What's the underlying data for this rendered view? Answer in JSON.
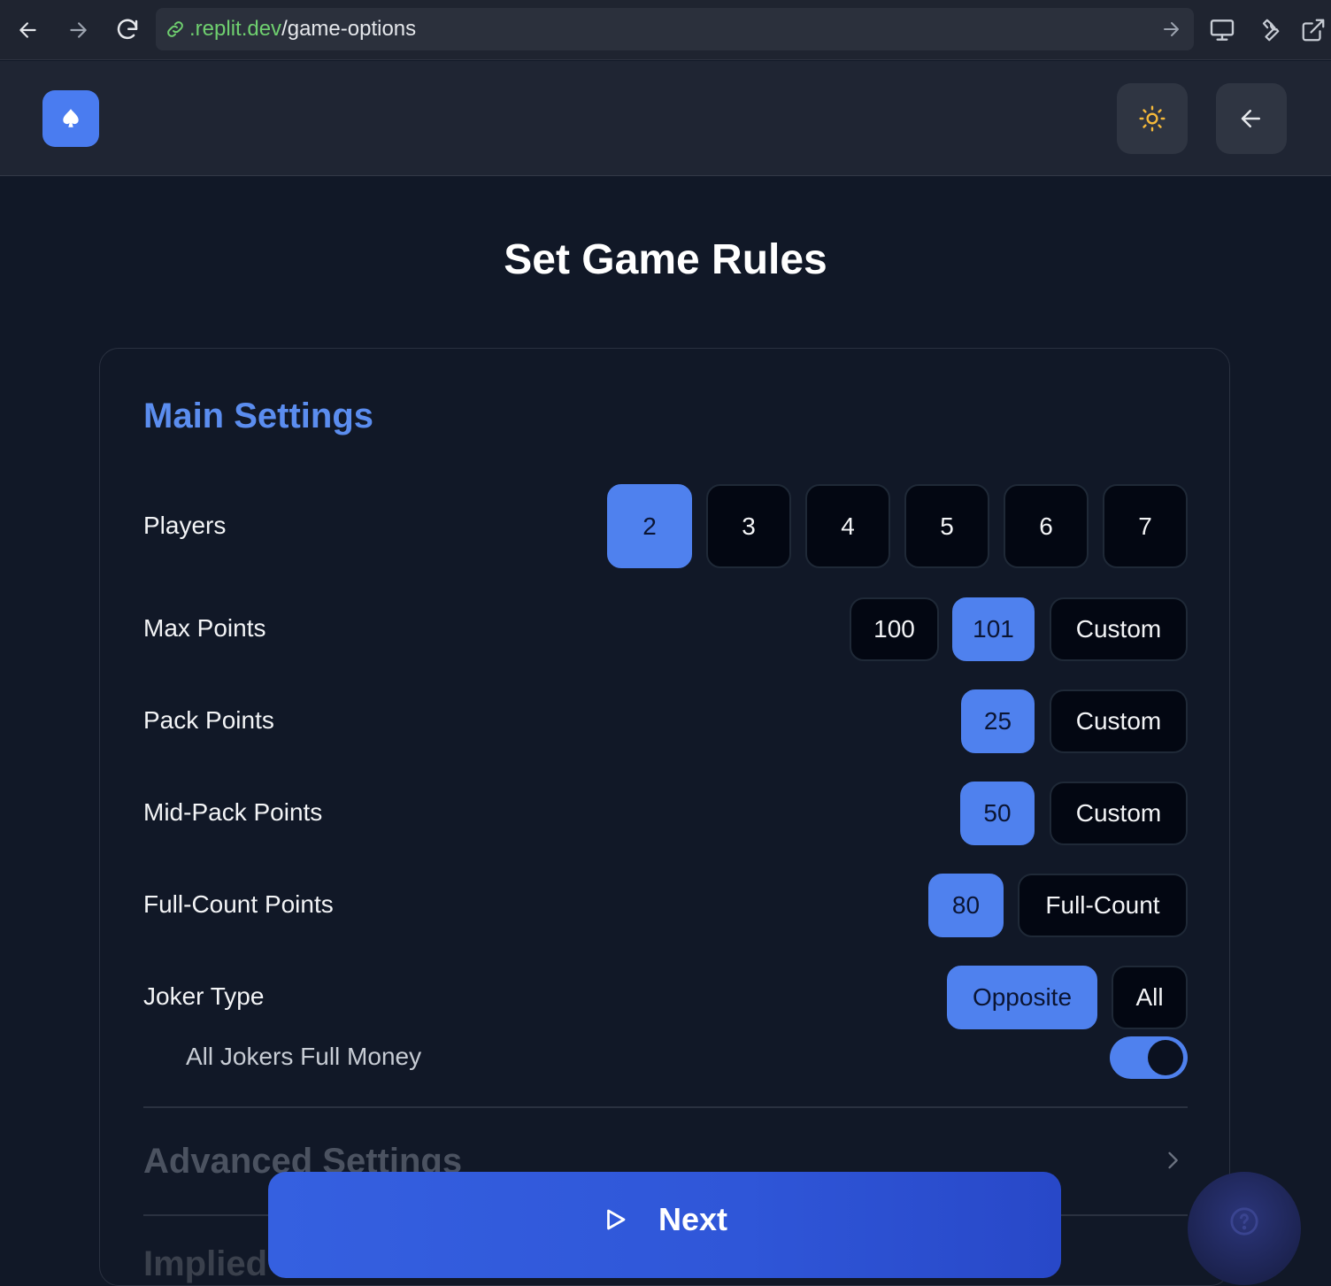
{
  "browser": {
    "url_domain": ".replit.dev",
    "url_path": "/game-options"
  },
  "page": {
    "title": "Set Game Rules"
  },
  "main_settings": {
    "title": "Main Settings",
    "players": {
      "label": "Players",
      "options": [
        "2",
        "3",
        "4",
        "5",
        "6",
        "7"
      ],
      "selected": "2"
    },
    "max_points": {
      "label": "Max Points",
      "options": [
        "100",
        "101",
        "Custom"
      ],
      "selected": "101"
    },
    "pack_points": {
      "label": "Pack Points",
      "options": [
        "25",
        "Custom"
      ],
      "selected": "25"
    },
    "mid_pack_points": {
      "label": "Mid-Pack Points",
      "options": [
        "50",
        "Custom"
      ],
      "selected": "50"
    },
    "full_count_points": {
      "label": "Full-Count Points",
      "options": [
        "80",
        "Full-Count"
      ],
      "selected": "80"
    },
    "joker_type": {
      "label": "Joker Type",
      "options": [
        "Opposite",
        "All"
      ],
      "selected": "Opposite"
    },
    "all_jokers_full_money": {
      "label": "All Jokers Full Money",
      "enabled": true
    }
  },
  "advanced_settings": {
    "title": "Advanced Settings"
  },
  "implied_settings": {
    "title": "Implied"
  },
  "actions": {
    "next_label": "Next"
  },
  "colors": {
    "accent": "#4f81ee",
    "background": "#111827",
    "section_title": "#5b8def"
  }
}
